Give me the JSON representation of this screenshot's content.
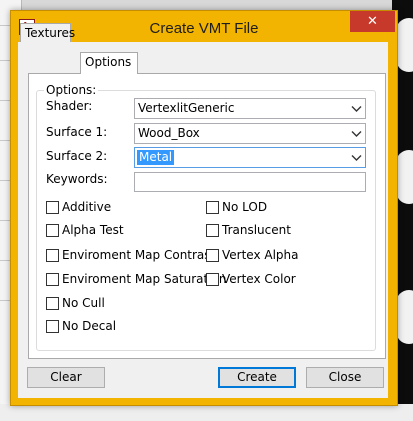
{
  "window": {
    "title": "Create VMT File",
    "close_glyph": "✕"
  },
  "tabs": [
    {
      "label": "Textures",
      "active": false
    },
    {
      "label": "Options",
      "active": true
    }
  ],
  "options": {
    "group_title": "Options:",
    "shader": {
      "label": "Shader:",
      "value": "VertexlitGeneric"
    },
    "surface1": {
      "label": "Surface 1:",
      "value": "Wood_Box"
    },
    "surface2": {
      "label": "Surface 2:",
      "value": "Metal"
    },
    "keywords": {
      "label": "Keywords:",
      "value": ""
    }
  },
  "checkboxes_left": [
    {
      "label": "Additive",
      "checked": false
    },
    {
      "label": "Alpha Test",
      "checked": false
    },
    {
      "label": "Enviroment Map Contrast",
      "checked": false
    },
    {
      "label": "Enviroment Map Saturation",
      "checked": false
    },
    {
      "label": "No Cull",
      "checked": false
    },
    {
      "label": "No Decal",
      "checked": false
    }
  ],
  "checkboxes_right": [
    {
      "label": "No LOD",
      "checked": false
    },
    {
      "label": "Translucent",
      "checked": false
    },
    {
      "label": "Vertex Alpha",
      "checked": false
    },
    {
      "label": "Vertex Color",
      "checked": false
    }
  ],
  "buttons": {
    "clear": "Clear",
    "create": "Create",
    "close": "Close"
  },
  "colors": {
    "titlebar": "#f2b400",
    "close_button": "#c7392a",
    "selection": "#3399ff",
    "primary_border": "#0078d7"
  },
  "icons": {
    "app": "hl-lambda-app-icon",
    "dropdown": "chevron-down-icon"
  }
}
